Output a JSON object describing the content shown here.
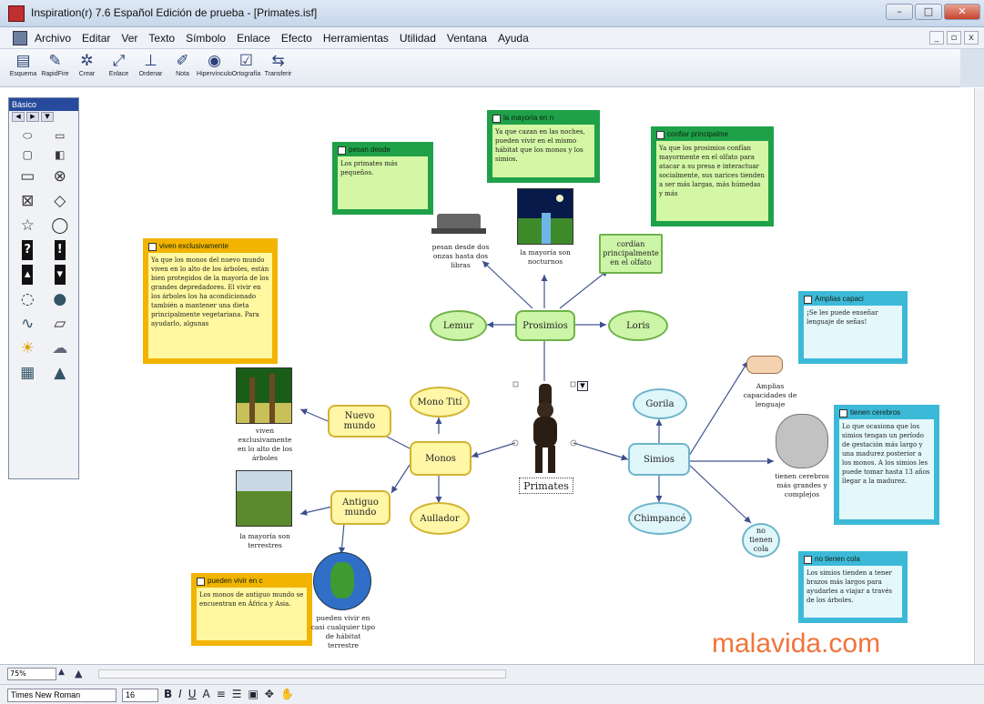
{
  "window": {
    "title": "Inspiration(r) 7.6 Español Edición de prueba - [Primates.isf]"
  },
  "menu": [
    "Archivo",
    "Editar",
    "Ver",
    "Texto",
    "Símbolo",
    "Enlace",
    "Efecto",
    "Herramientas",
    "Utilidad",
    "Ventana",
    "Ayuda"
  ],
  "toolbar": [
    {
      "label": "Esquema",
      "icon": "outline-icon"
    },
    {
      "label": "RapidFire",
      "icon": "rapidfire-icon"
    },
    {
      "label": "Crear",
      "icon": "create-icon"
    },
    {
      "label": "Enlace",
      "icon": "link-icon"
    },
    {
      "label": "Ordenar",
      "icon": "arrange-icon"
    },
    {
      "label": "Nota",
      "icon": "note-icon"
    },
    {
      "label": "Hipervínculo",
      "icon": "hyperlink-icon"
    },
    {
      "label": "Ortografía",
      "icon": "spell-check-icon"
    },
    {
      "label": "Transferir",
      "icon": "transfer-icon"
    }
  ],
  "palette": {
    "title": "Básico"
  },
  "nodes": {
    "primates": "Primates",
    "prosimios": "Prosimios",
    "lemur": "Lemur",
    "loris": "Loris",
    "monos": "Monos",
    "mono_titi": "Mono Tití",
    "aullador": "Aullador",
    "nuevo_mundo": "Nuevo mundo",
    "antiguo_mundo": "Antiguo mundo",
    "simios": "Simios",
    "gorila": "Gorila",
    "chimpance": "Chimpancé",
    "no_tienen_cola": "no tienen cola",
    "cordan": "cordían principalmente en el olfato"
  },
  "notes": {
    "pesan": {
      "head": "pesan desde",
      "body": "Los primates más pequeños."
    },
    "mayoria": {
      "head": "la mayoría en n",
      "body": "Ya que cazan en las noches, pueden vivir en el mismo hábitat que los monos y los simios."
    },
    "confiar": {
      "head": "confiar principalme",
      "body": "Ya que los prosimios confían mayormente en el olfato para atacar a su presa e interactuar socialmente, sus narices tienden a ser más largas, más húmedas y más"
    },
    "viven": {
      "head": "viven exclusivamente",
      "body": "Ya que los monos del nuevo mundo viven en lo alto de los árboles, están bien protegidos de la mayoría de los grandes depredadores. El vivir en los árboles los ha acondicionado también a mantener una dieta principalmente vegetariana. Para ayudarlo, algunas"
    },
    "amplias": {
      "head": "Amplias capaci",
      "body": "¡Se les puede enseñar lenguaje de señas!"
    },
    "cerebros": {
      "head": "tienen cerebros",
      "body": "Lo que ocasiona que los simios tengan un período de gestación más largo y una madurez posterior a los monos. A los simios les puede tomar hasta 13 años llegar a la madurez."
    },
    "cola": {
      "head": "no tienen cola",
      "body": "Los simios tienden a tener brazos más largos para ayudarles a viajar a través de los árboles."
    },
    "africa": {
      "head": "pueden vivir en c",
      "body": "Los monos de antiguo mundo se encuentran en África y Asia."
    }
  },
  "captions": {
    "pesan": "pesan desde dos onzas hasta dos libras",
    "nocturnos": "la mayoría son nocturnos",
    "arboles": "viven exclusivamente en lo alto de los árboles",
    "terrestres": "la mayoría son terrestres",
    "habitat": "pueden vivir en casi cualquier tipo de hábitat terrestre",
    "lenguaje": "Amplias capacidades de lenguaje",
    "cerebros": "tienen cerebros más grandes y complejos"
  },
  "watermark": "malavida.com",
  "status": {
    "zoom": "75%"
  },
  "format": {
    "font": "Times New Roman",
    "size": "16"
  },
  "colors": {
    "green_note": "#1fa14a",
    "yellow_note": "#f2b400",
    "blue_note": "#3db9d8",
    "title_bar": "#c6d6ea"
  }
}
